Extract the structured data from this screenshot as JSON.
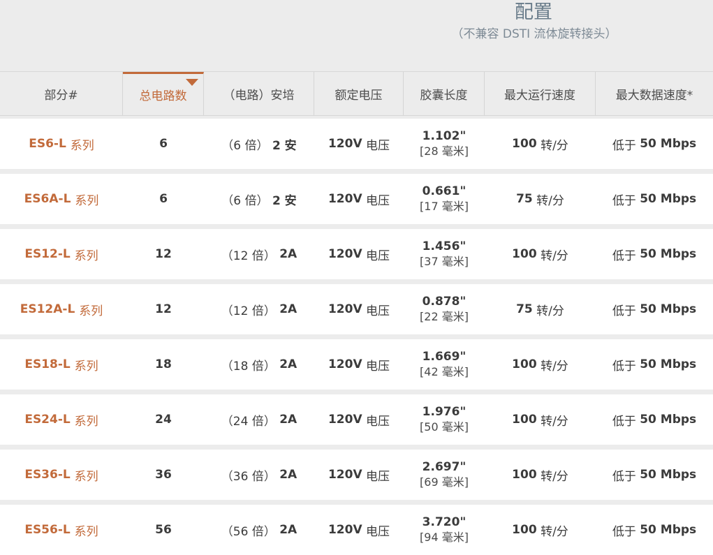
{
  "config": {
    "title": "配置",
    "subtitle": "（不兼容 DSTI 流体旋转接头）"
  },
  "columns": [
    "部分#",
    "总电路数",
    "（电路）安培",
    "额定电压",
    "胶囊长度",
    "最大运行速度",
    "最大数据速度*"
  ],
  "active_column": 1,
  "rows": [
    {
      "part": "ES6-L",
      "series": "系列",
      "circuits": "6",
      "multiplier": "6 倍",
      "amps": "2 安",
      "voltage": "120V",
      "voltage_unit": "电压",
      "length_in": "1.102\"",
      "length_mm_value": "[28",
      "length_mm_unit": "毫米]",
      "speed_value": "100",
      "speed_unit": "转/分",
      "data_prefix": "低于",
      "data_value": "50 Mbps"
    },
    {
      "part": "ES6A-L",
      "series": "系列",
      "circuits": "6",
      "multiplier": "6 倍",
      "amps": "2 安",
      "voltage": "120V",
      "voltage_unit": "电压",
      "length_in": "0.661\"",
      "length_mm_value": "[17",
      "length_mm_unit": "毫米]",
      "speed_value": "75",
      "speed_unit": "转/分",
      "data_prefix": "低于",
      "data_value": "50 Mbps"
    },
    {
      "part": "ES12-L",
      "series": "系列",
      "circuits": "12",
      "multiplier": "12 倍",
      "amps": "2A",
      "voltage": "120V",
      "voltage_unit": "电压",
      "length_in": "1.456\"",
      "length_mm_value": "[37",
      "length_mm_unit": "毫米]",
      "speed_value": "100",
      "speed_unit": "转/分",
      "data_prefix": "低于",
      "data_value": "50 Mbps"
    },
    {
      "part": "ES12A-L",
      "series": "系列",
      "circuits": "12",
      "multiplier": "12 倍",
      "amps": "2A",
      "voltage": "120V",
      "voltage_unit": "电压",
      "length_in": "0.878\"",
      "length_mm_value": "[22",
      "length_mm_unit": "毫米]",
      "speed_value": "75",
      "speed_unit": "转/分",
      "data_prefix": "低于",
      "data_value": "50 Mbps"
    },
    {
      "part": "ES18-L",
      "series": "系列",
      "circuits": "18",
      "multiplier": "18 倍",
      "amps": "2A",
      "voltage": "120V",
      "voltage_unit": "电压",
      "length_in": "1.669\"",
      "length_mm_value": "[42",
      "length_mm_unit": "毫米]",
      "speed_value": "100",
      "speed_unit": "转/分",
      "data_prefix": "低于",
      "data_value": "50 Mbps"
    },
    {
      "part": "ES24-L",
      "series": "系列",
      "circuits": "24",
      "multiplier": "24 倍",
      "amps": "2A",
      "voltage": "120V",
      "voltage_unit": "电压",
      "length_in": "1.976\"",
      "length_mm_value": "[50",
      "length_mm_unit": "毫米]",
      "speed_value": "100",
      "speed_unit": "转/分",
      "data_prefix": "低于",
      "data_value": "50 Mbps"
    },
    {
      "part": "ES36-L",
      "series": "系列",
      "circuits": "36",
      "multiplier": "36 倍",
      "amps": "2A",
      "voltage": "120V",
      "voltage_unit": "电压",
      "length_in": "2.697\"",
      "length_mm_value": "[69",
      "length_mm_unit": "毫米]",
      "speed_value": "100",
      "speed_unit": "转/分",
      "data_prefix": "低于",
      "data_value": "50 Mbps"
    },
    {
      "part": "ES56-L",
      "series": "系列",
      "circuits": "56",
      "multiplier": "56 倍",
      "amps": "2A",
      "voltage": "120V",
      "voltage_unit": "电压",
      "length_in": "3.720\"",
      "length_mm_value": "[94",
      "length_mm_unit": "毫米]",
      "speed_value": "100",
      "speed_unit": "转/分",
      "data_prefix": "低于",
      "data_value": "50 Mbps"
    }
  ],
  "colors": {
    "accent": "#c26a3a",
    "header_bg": "#ececec",
    "row_bg": "#ffffff",
    "title": "#697c8a"
  }
}
